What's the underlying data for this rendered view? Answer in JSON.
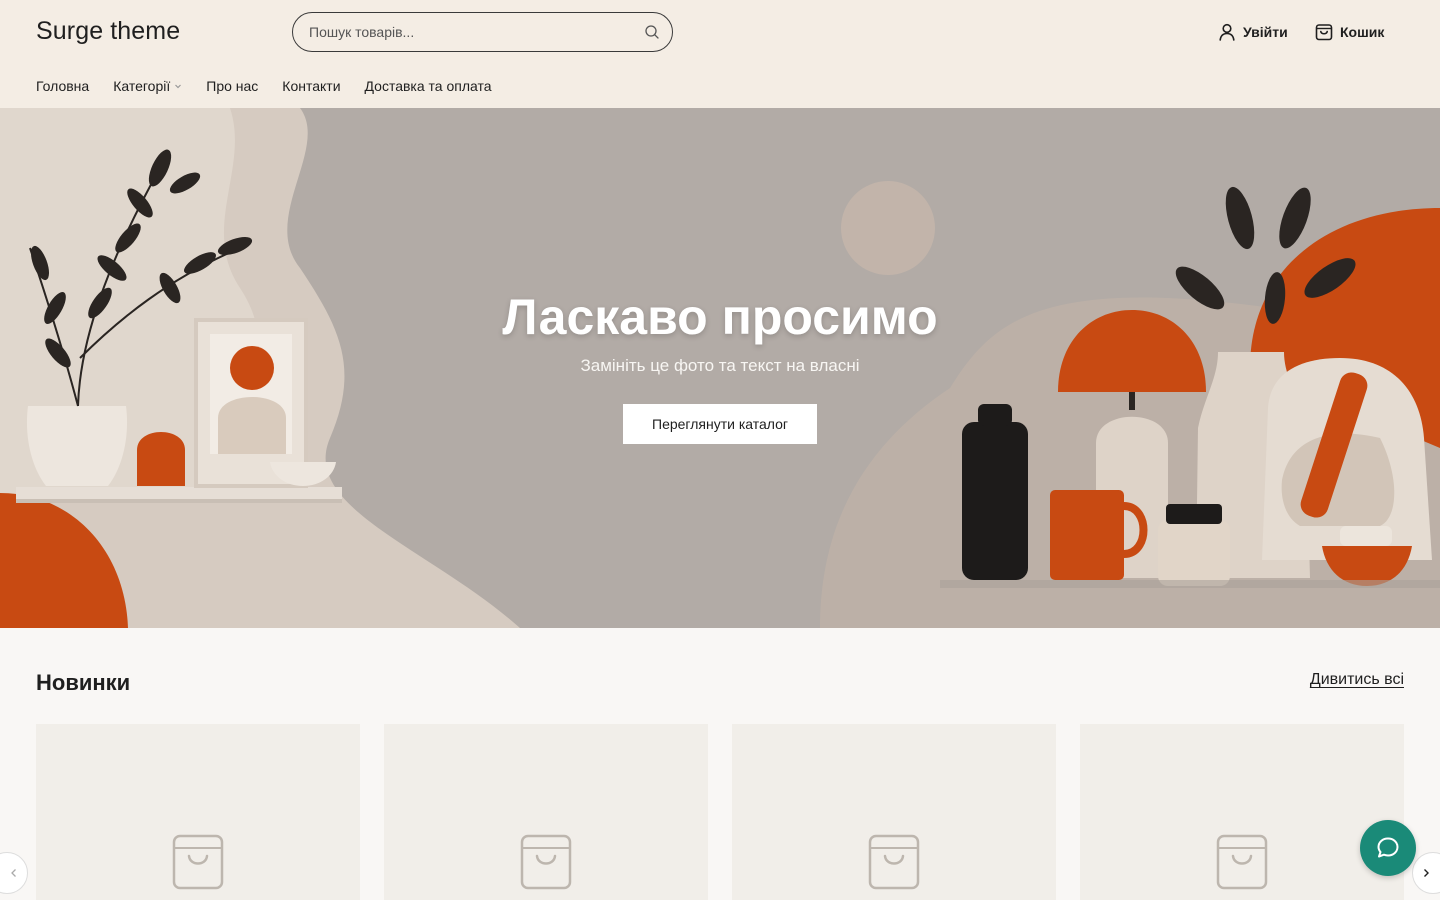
{
  "header": {
    "logo": "Surge theme",
    "search_placeholder": "Пошук товарів...",
    "login_label": "Увійти",
    "cart_label": "Кошик"
  },
  "nav": {
    "items": [
      "Головна",
      "Категорії",
      "Про нас",
      "Контакти",
      "Доставка та оплата"
    ]
  },
  "hero": {
    "title": "Ласкаво просимо",
    "subtitle": "Замініть це фото та текст на власні",
    "button_label": "Переглянути каталог"
  },
  "new_arrivals": {
    "title": "Новинки",
    "view_all_label": "Дивитись всі",
    "cards": [
      "placeholder",
      "placeholder",
      "placeholder",
      "placeholder"
    ]
  },
  "icons": {
    "search": "search-icon",
    "user": "user-icon",
    "cart": "shopping-bag-icon",
    "chat": "chat-icon"
  },
  "colors": {
    "header_bg": "#f4ede4",
    "hero_bg": "#b2aba6",
    "accent_orange": "#c84a12",
    "chat_button": "#1a8a78"
  }
}
